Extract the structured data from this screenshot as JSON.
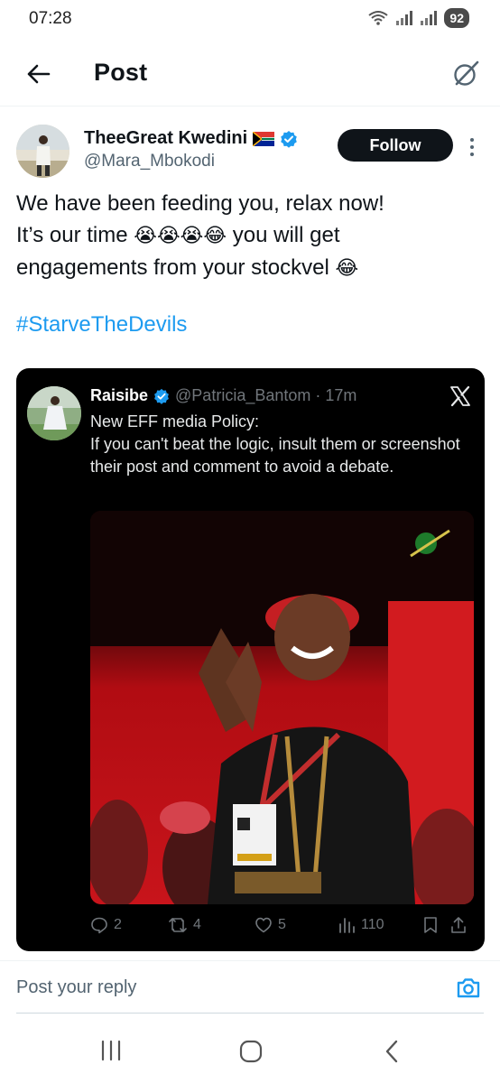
{
  "status_bar": {
    "time": "07:28",
    "battery": "92",
    "icons": [
      "wifi-icon",
      "signal-icon",
      "signal-icon"
    ]
  },
  "header": {
    "title": "Post",
    "back_icon": "arrow-left-icon",
    "grok_icon": "grok-icon"
  },
  "post": {
    "author_name": "TheeGreat Kwedini",
    "author_flag": "🇿🇦",
    "author_handle": "@Mara_Mbokodi",
    "follow_label": "Follow",
    "text_line1": "We have been feeding you, relax now!",
    "text_line2_a": "It’s our time ",
    "text_line2_emoji": "😭😭😭😂",
    "text_line2_b": " you will get",
    "text_line3_a": "engagements from your stockvel ",
    "text_line3_emoji": "😂",
    "hashtag": "#StarveTheDevils"
  },
  "quote": {
    "author_name": "Raisibe",
    "author_handle": "@Patricia_Bantom",
    "time_sep": " · ",
    "time": "17m",
    "text_line1": "New EFF media Policy:",
    "text_line2": "If you can't beat the logic, insult them or screenshot their post and comment to avoid a debate.",
    "actions": {
      "replies": "2",
      "reposts": "4",
      "likes": "5",
      "views": "110"
    }
  },
  "reply": {
    "placeholder": "Post your reply"
  },
  "colors": {
    "accent": "#1d9bf0",
    "text": "#0f1419",
    "muted": "#536471",
    "quote_bg": "#000000"
  }
}
